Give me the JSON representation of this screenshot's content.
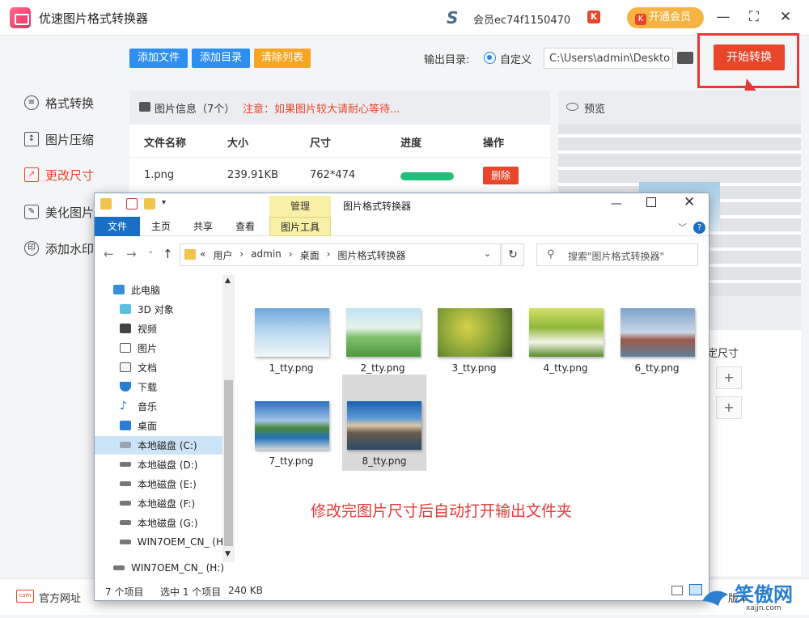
{
  "app": {
    "title": "优速图片格式转换器",
    "member": "会员ec74f1150470",
    "vip_badge": "K",
    "open_vip": "开通会员"
  },
  "window": {
    "minimize": "—",
    "maximize": "⛶",
    "close": "✕"
  },
  "sidebar": {
    "items": [
      {
        "label": "格式转换"
      },
      {
        "label": "图片压缩"
      },
      {
        "label": "更改尺寸"
      },
      {
        "label": "美化图片"
      },
      {
        "label": "添加水印"
      }
    ]
  },
  "toolbar": {
    "add_file": "添加文件",
    "add_dir": "添加目录",
    "clear_list": "清除列表",
    "output_label": "输出目录:",
    "custom_label": "自定义",
    "output_path": "C:\\Users\\admin\\Deskto",
    "start": "开始转换"
  },
  "info": {
    "title": "图片信息（7个）",
    "note": "注意：如果图片较大请耐心等待..."
  },
  "table": {
    "headers": [
      "文件名称",
      "大小",
      "尺寸",
      "进度",
      "操作"
    ],
    "rows": [
      {
        "name": "1.png",
        "size": "239.91KB",
        "dims": "762*474",
        "progress": 1.0,
        "action": "删除"
      }
    ]
  },
  "preview": {
    "title": "预览",
    "resize_label": "定尺寸",
    "plus": "+"
  },
  "bottom": {
    "site": "官方网址",
    "site_icon": "com",
    "right_label": "版本"
  },
  "explorer": {
    "title": "图片格式转换器",
    "manage": "管理",
    "tabs": [
      "文件",
      "主页",
      "共享",
      "查看",
      "图片工具"
    ],
    "path": [
      "«",
      "用户",
      "›",
      "admin",
      "›",
      "桌面",
      "›",
      "图片格式转换器"
    ],
    "search_placeholder": "搜索\"图片格式转换器\"",
    "nav": [
      "此电脑",
      "3D 对象",
      "视频",
      "图片",
      "文档",
      "下载",
      "音乐",
      "桌面",
      "本地磁盘 (C:)",
      "本地磁盘 (D:)",
      "本地磁盘 (E:)",
      "本地磁盘 (F:)",
      "本地磁盘 (G:)",
      "WIN7OEM_CN_ (H",
      "WIN7OEM_CN_ (H:)"
    ],
    "files": [
      {
        "name": "1_tty.png"
      },
      {
        "name": "2_tty.png"
      },
      {
        "name": "3_tty.png"
      },
      {
        "name": "4_tty.png"
      },
      {
        "name": "6_tty.png"
      },
      {
        "name": "7_tty.png"
      },
      {
        "name": "8_tty.png"
      }
    ],
    "caption": "修改完图片尺寸后自动打开输出文件夹",
    "status": {
      "count": "7 个项目",
      "selected": "选中 1 个项目",
      "size": "240 KB"
    }
  },
  "watermark": {
    "text": "笑傲网",
    "domain": "xajjn.com"
  },
  "colors": {
    "accent": "#e8452a",
    "blue_btn": "#2196f3",
    "orange_btn": "#f5a623",
    "progress": "#1fbf7a"
  }
}
